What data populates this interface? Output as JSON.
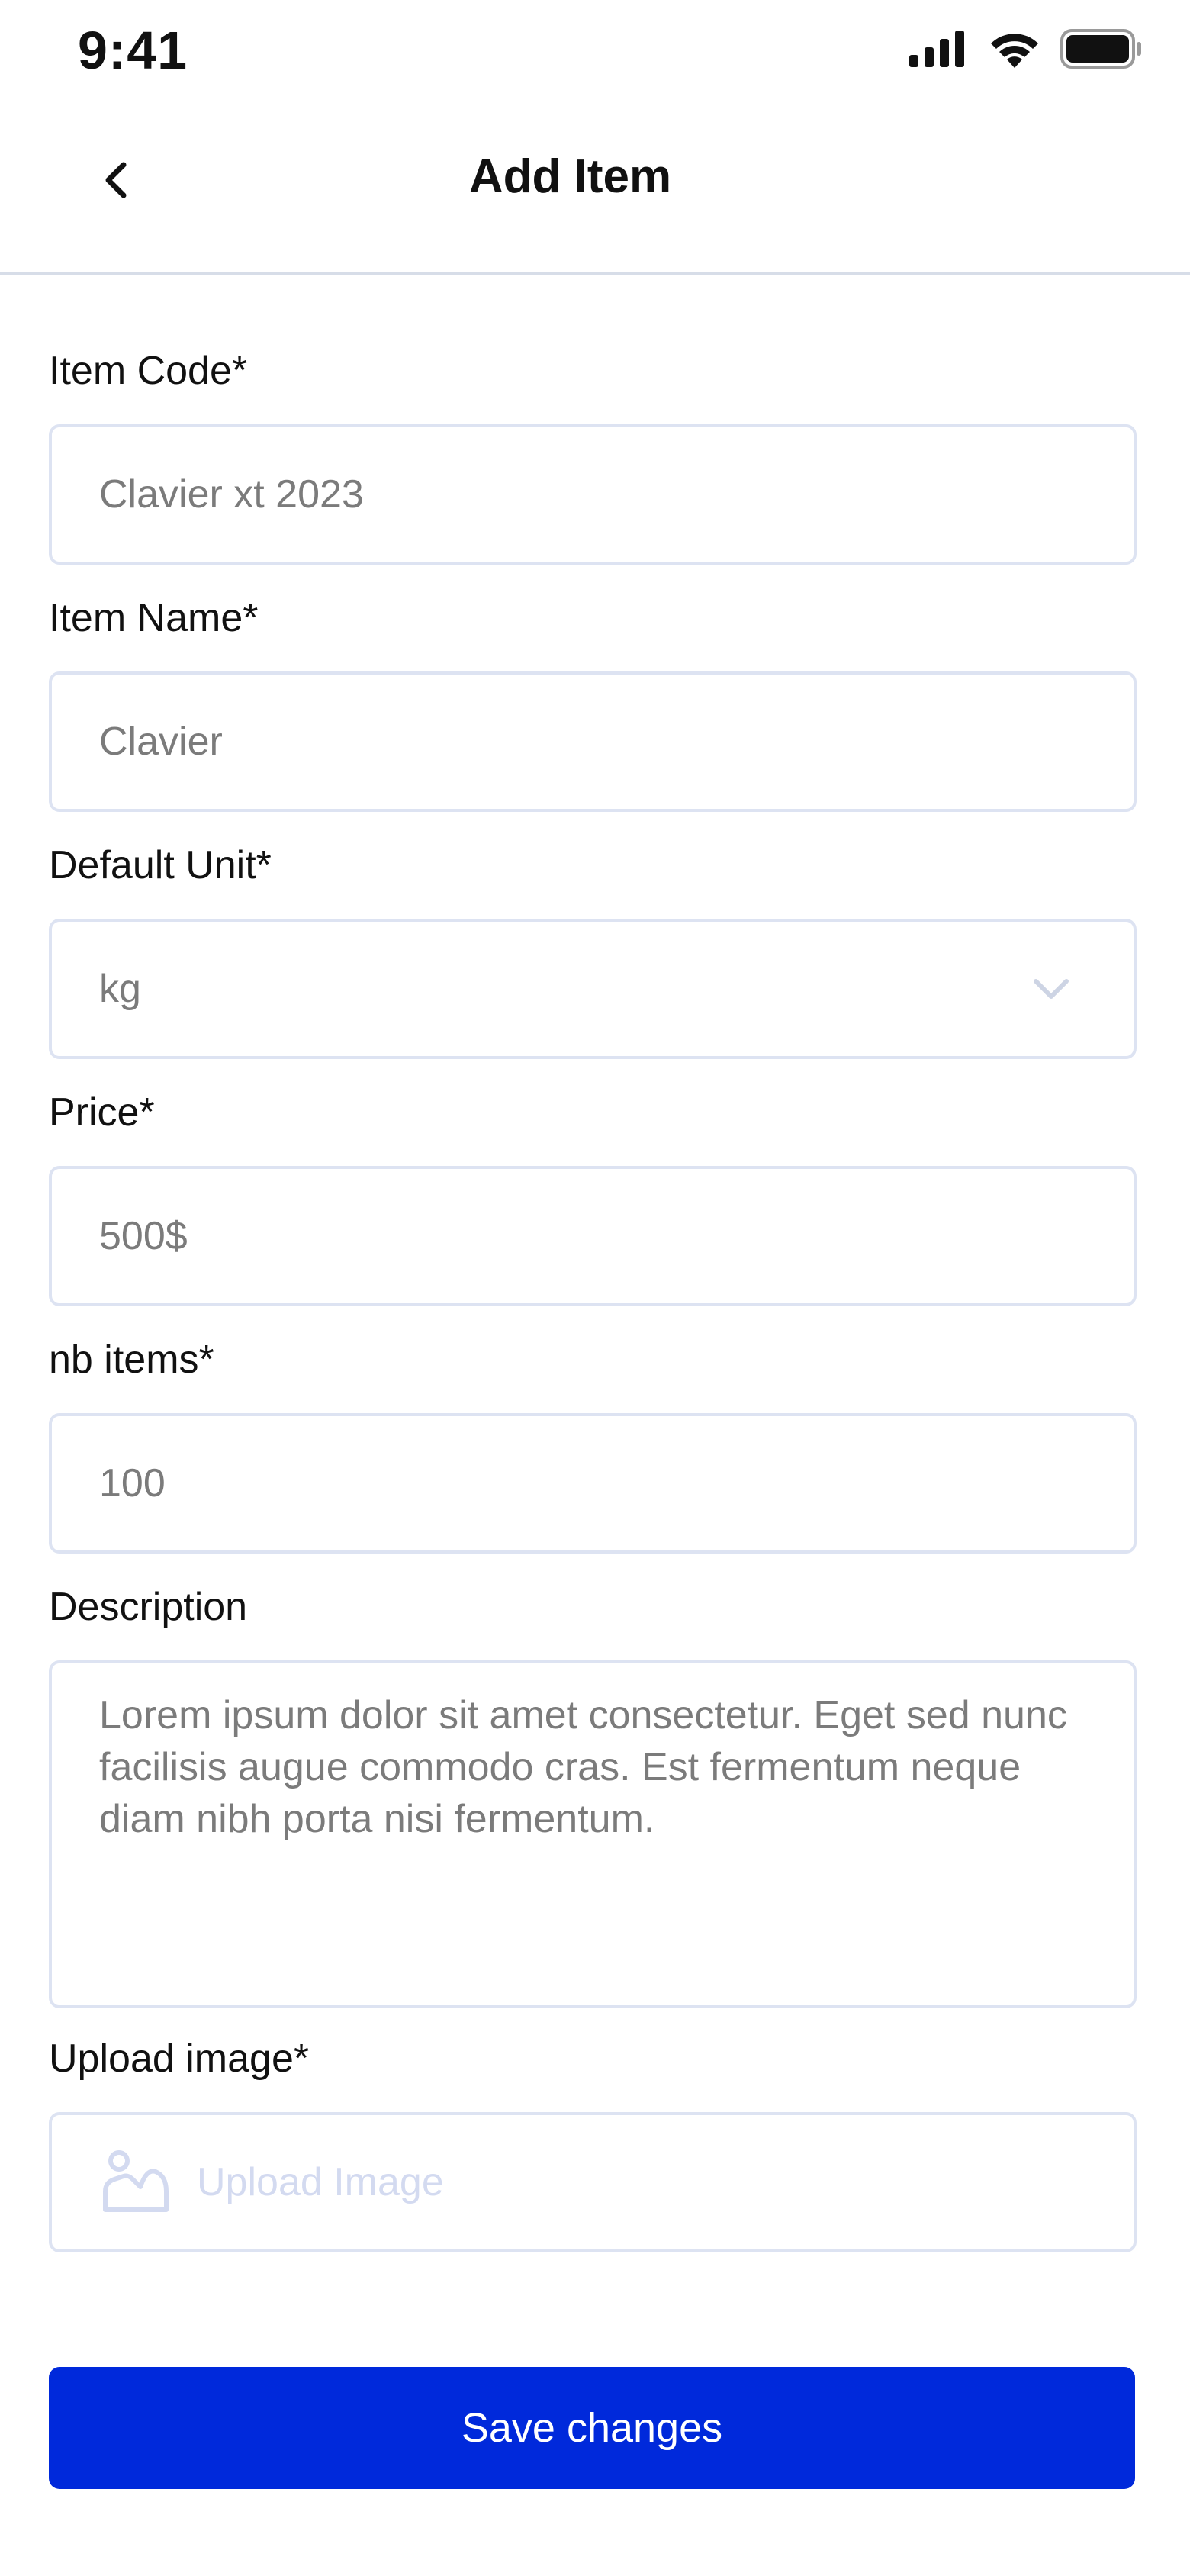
{
  "status_bar": {
    "time": "9:41",
    "icons": [
      "signal-icon",
      "wifi-icon",
      "battery-icon"
    ]
  },
  "header": {
    "back_icon": "chevron-left-icon",
    "title": "Add Item"
  },
  "form": {
    "item_code": {
      "label": "Item Code*",
      "value": "Clavier xt 2023"
    },
    "item_name": {
      "label": "Item Name*",
      "value": "Clavier"
    },
    "default_unit": {
      "label": "Default Unit*",
      "selected": "kg",
      "icon": "chevron-down-icon"
    },
    "price": {
      "label": "Price*",
      "value": "500$"
    },
    "nb_items": {
      "label": "nb items*",
      "value": "100"
    },
    "description": {
      "label": "Description",
      "value": "Lorem ipsum dolor sit amet consectetur. Eget sed nunc facilisis augue commodo cras. Est fermentum neque diam nibh porta nisi fermentum."
    },
    "upload_image": {
      "label": "Upload image*",
      "placeholder": "Upload Image",
      "icon": "image-icon"
    }
  },
  "actions": {
    "save_label": "Save changes"
  },
  "colors": {
    "primary": "#0029db",
    "border": "#dde3f2",
    "value_text": "#7b7b7b",
    "placeholder_text": "#d3daf0"
  }
}
